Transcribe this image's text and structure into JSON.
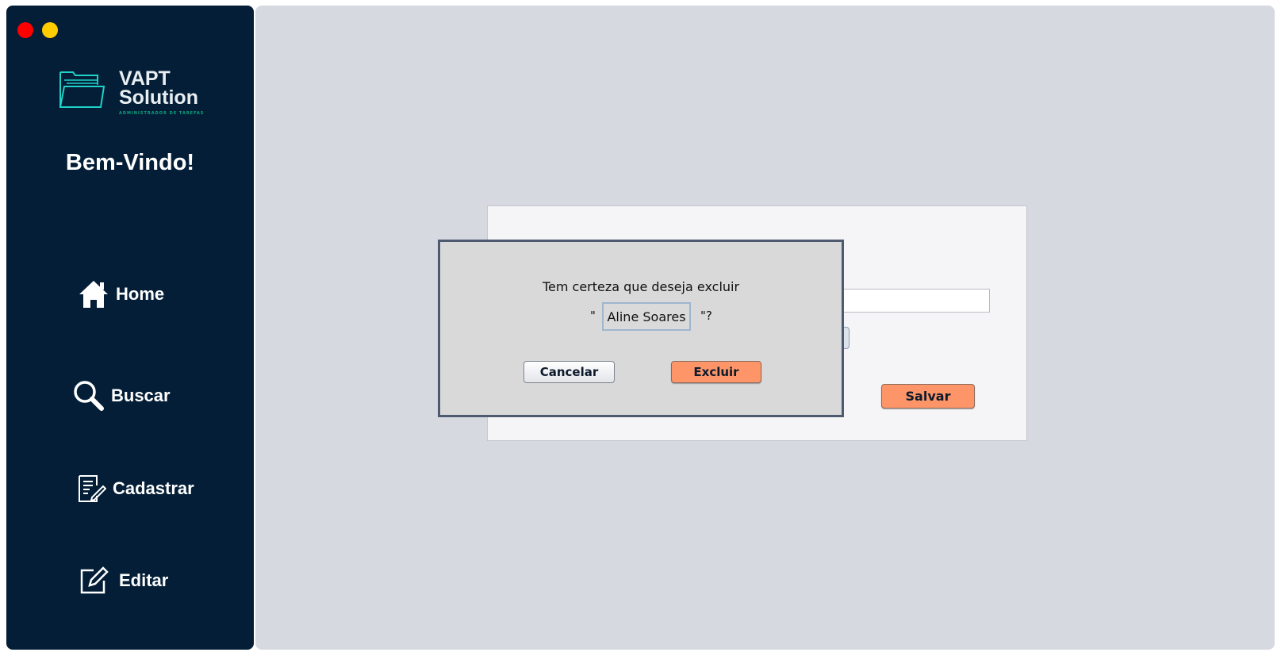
{
  "window": {
    "controls": {
      "close_color": "#ff0000",
      "minimize_color": "#ffcc00"
    }
  },
  "sidebar": {
    "logo": {
      "line1": "VAPT",
      "line2": "Solution",
      "tagline": "ADMINISTRADOR DE TAREFAS"
    },
    "welcome": "Bem-Vindo!",
    "items": [
      {
        "label": "Home",
        "icon": "home-icon"
      },
      {
        "label": "Buscar",
        "icon": "search-icon"
      },
      {
        "label": "Cadastrar",
        "icon": "register-form-icon"
      },
      {
        "label": "Editar",
        "icon": "edit-icon"
      }
    ]
  },
  "form": {
    "save_label": "Salvar"
  },
  "dialog": {
    "message": "Tem certeza que deseja excluir",
    "quote_open": "\"",
    "name": "Aline Soares",
    "quote_close": "\"?",
    "cancel_label": "Cancelar",
    "delete_label": "Excluir"
  },
  "colors": {
    "sidebar": "#031e36",
    "accent": "#fd9568",
    "logo": "#1fd1c6"
  }
}
